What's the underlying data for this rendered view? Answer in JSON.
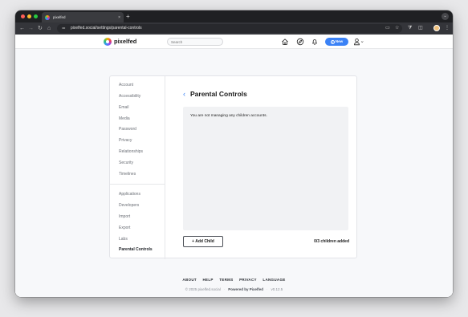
{
  "browser": {
    "tab_title": "pixelfed",
    "tab_close": "×",
    "new_tab": "+",
    "url": "pixelfed.social/settings/parental-controls",
    "icons": [
      "back-icon",
      "forward-icon",
      "reload-icon",
      "home-icon",
      "site-settings-icon",
      "install-icon",
      "bookmark-star-icon",
      "extensions-icon",
      "sidebar-icon",
      "profile-icon",
      "menu-icon"
    ]
  },
  "navbar": {
    "brand": "pixelfed",
    "search_placeholder": "Search",
    "new_button": "New",
    "icons": [
      "home-icon",
      "explore-icon",
      "notifications-icon",
      "user-icon"
    ]
  },
  "sidebar": {
    "items": [
      {
        "label": "Account"
      },
      {
        "label": "Accessibility"
      },
      {
        "label": "Email"
      },
      {
        "label": "Media"
      },
      {
        "label": "Password"
      },
      {
        "label": "Privacy"
      },
      {
        "label": "Relationships"
      },
      {
        "label": "Security"
      },
      {
        "label": "Timelines"
      }
    ],
    "secondary_items": [
      {
        "label": "Applications"
      },
      {
        "label": "Developers"
      },
      {
        "label": "Import"
      },
      {
        "label": "Export"
      },
      {
        "label": "Labs"
      },
      {
        "label": "Parental Controls"
      }
    ]
  },
  "main": {
    "title": "Parental Controls",
    "back_glyph": "‹",
    "empty_message": "You are not managing any children accounts.",
    "add_button": "+ Add Child",
    "children_count": "0/3 children added"
  },
  "footer": {
    "links": [
      "ABOUT",
      "HELP",
      "TERMS",
      "PRIVACY",
      "LANGUAGE"
    ],
    "copyright": "© 2025 pixelfed.social",
    "powered_by": "Powered by Pixelfed",
    "version": "v0.12.5"
  },
  "colors": {
    "accent": "#3b82f6",
    "page_background": "#f7f8fa",
    "panel_background": "#f1f2f4"
  }
}
